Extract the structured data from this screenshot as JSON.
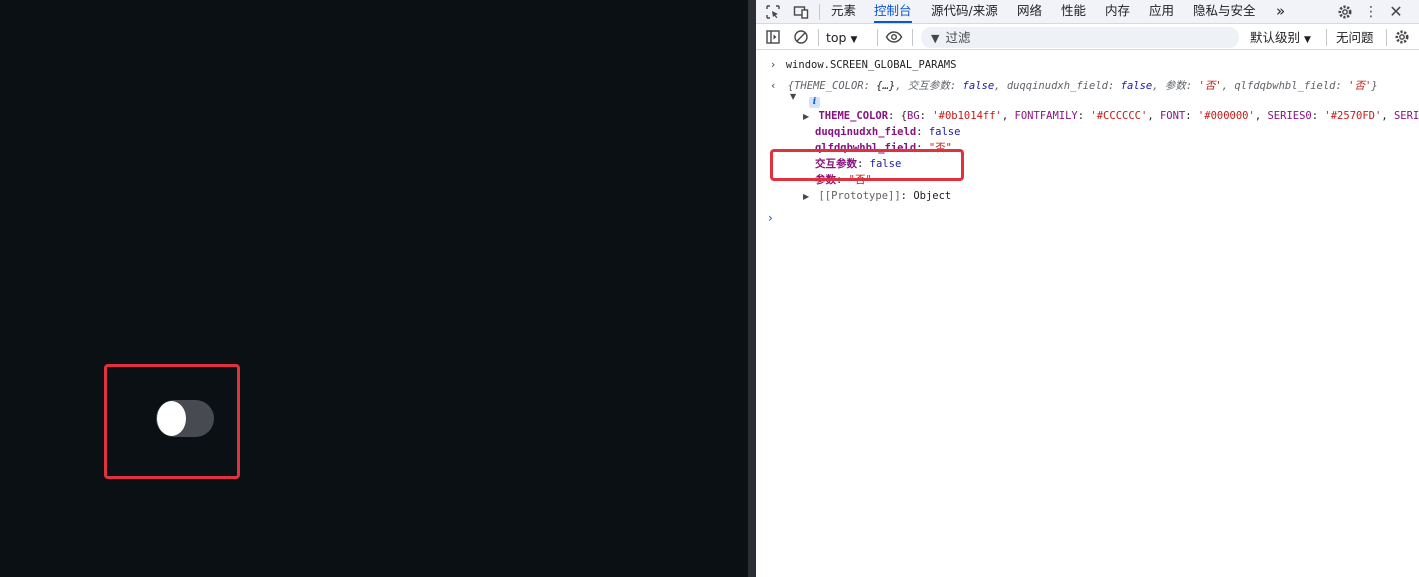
{
  "page": {
    "toggle": {
      "state": "off"
    },
    "highlight_color": "#e0313f"
  },
  "devtools": {
    "tabs": [
      {
        "label": "元素"
      },
      {
        "label": "控制台"
      },
      {
        "label": "源代码/来源"
      },
      {
        "label": "网络"
      },
      {
        "label": "性能"
      },
      {
        "label": "内存"
      },
      {
        "label": "应用"
      },
      {
        "label": "隐私与安全"
      }
    ],
    "more_tabs": "»",
    "toolbar": {
      "context": "top",
      "filter_placeholder": "过滤",
      "levels": "默认级别",
      "issues": "无问题"
    },
    "console": {
      "input": "window.SCREEN_GLOBAL_PARAMS",
      "summary": {
        "k1": "THEME_COLOR",
        "v1": "{…}",
        "k2": "交互参数",
        "v2": "false",
        "k3": "duqqinudxh_field",
        "v3": "false",
        "k4": "参数",
        "v4": "'否'",
        "k5": "qlfdqbwhbl_field",
        "v5": "'否'"
      },
      "theme_color": {
        "key": "THEME_COLOR",
        "p1k": "BG",
        "p1v": "'#0b1014ff'",
        "p2k": "FONTFAMILY",
        "p2v": "'#CCCCCC'",
        "p3k": "FONT",
        "p3v": "'#000000'",
        "p4k": "SERIES0",
        "p4v": "'#2570FD'",
        "p5k": "SERI"
      },
      "props": [
        {
          "key": "duqqinudxh_field",
          "value": "false"
        },
        {
          "key": "qlfdqbwhbl_field",
          "value": "\"否\""
        },
        {
          "key": "交互参数",
          "value": "false"
        },
        {
          "key": "参数",
          "value": "\"否\""
        }
      ],
      "prototype": {
        "key": "[[Prototype]]",
        "value": "Object"
      }
    }
  }
}
